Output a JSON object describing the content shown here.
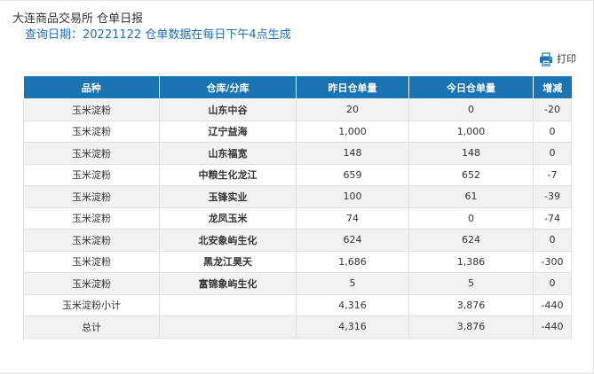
{
  "header": {
    "title": "大连商品交易所 仓单日报",
    "query_label": "查询日期：",
    "query_date": "20221122",
    "note": "仓单数据在每日下午4点生成",
    "print_label": "打印"
  },
  "table": {
    "columns": [
      "品种",
      "仓库/分库",
      "昨日仓单量",
      "今日仓单量",
      "增减"
    ],
    "rows": [
      {
        "variety": "玉米淀粉",
        "warehouse": "山东中谷",
        "yesterday": "20",
        "today": "0",
        "change": "-20"
      },
      {
        "variety": "玉米淀粉",
        "warehouse": "辽宁益海",
        "yesterday": "1,000",
        "today": "1,000",
        "change": "0"
      },
      {
        "variety": "玉米淀粉",
        "warehouse": "山东福宽",
        "yesterday": "148",
        "today": "148",
        "change": "0"
      },
      {
        "variety": "玉米淀粉",
        "warehouse": "中粮生化龙江",
        "yesterday": "659",
        "today": "652",
        "change": "-7"
      },
      {
        "variety": "玉米淀粉",
        "warehouse": "玉锋实业",
        "yesterday": "100",
        "today": "61",
        "change": "-39"
      },
      {
        "variety": "玉米淀粉",
        "warehouse": "龙凤玉米",
        "yesterday": "74",
        "today": "0",
        "change": "-74"
      },
      {
        "variety": "玉米淀粉",
        "warehouse": "北安象屿生化",
        "yesterday": "624",
        "today": "624",
        "change": "0"
      },
      {
        "variety": "玉米淀粉",
        "warehouse": "黑龙江昊天",
        "yesterday": "1,686",
        "today": "1,386",
        "change": "-300"
      },
      {
        "variety": "玉米淀粉",
        "warehouse": "富锦象屿生化",
        "yesterday": "5",
        "today": "5",
        "change": "0"
      }
    ],
    "subtotal": {
      "label": "玉米淀粉小计",
      "warehouse": "",
      "yesterday": "4,316",
      "today": "3,876",
      "change": "-440"
    },
    "total": {
      "label": "总计",
      "warehouse": "",
      "yesterday": "4,316",
      "today": "3,876",
      "change": "-440"
    }
  },
  "colors": {
    "header_bg": "#1a73b3",
    "query_text": "#1f6fb8",
    "row_alt": "#f2f2f2"
  }
}
